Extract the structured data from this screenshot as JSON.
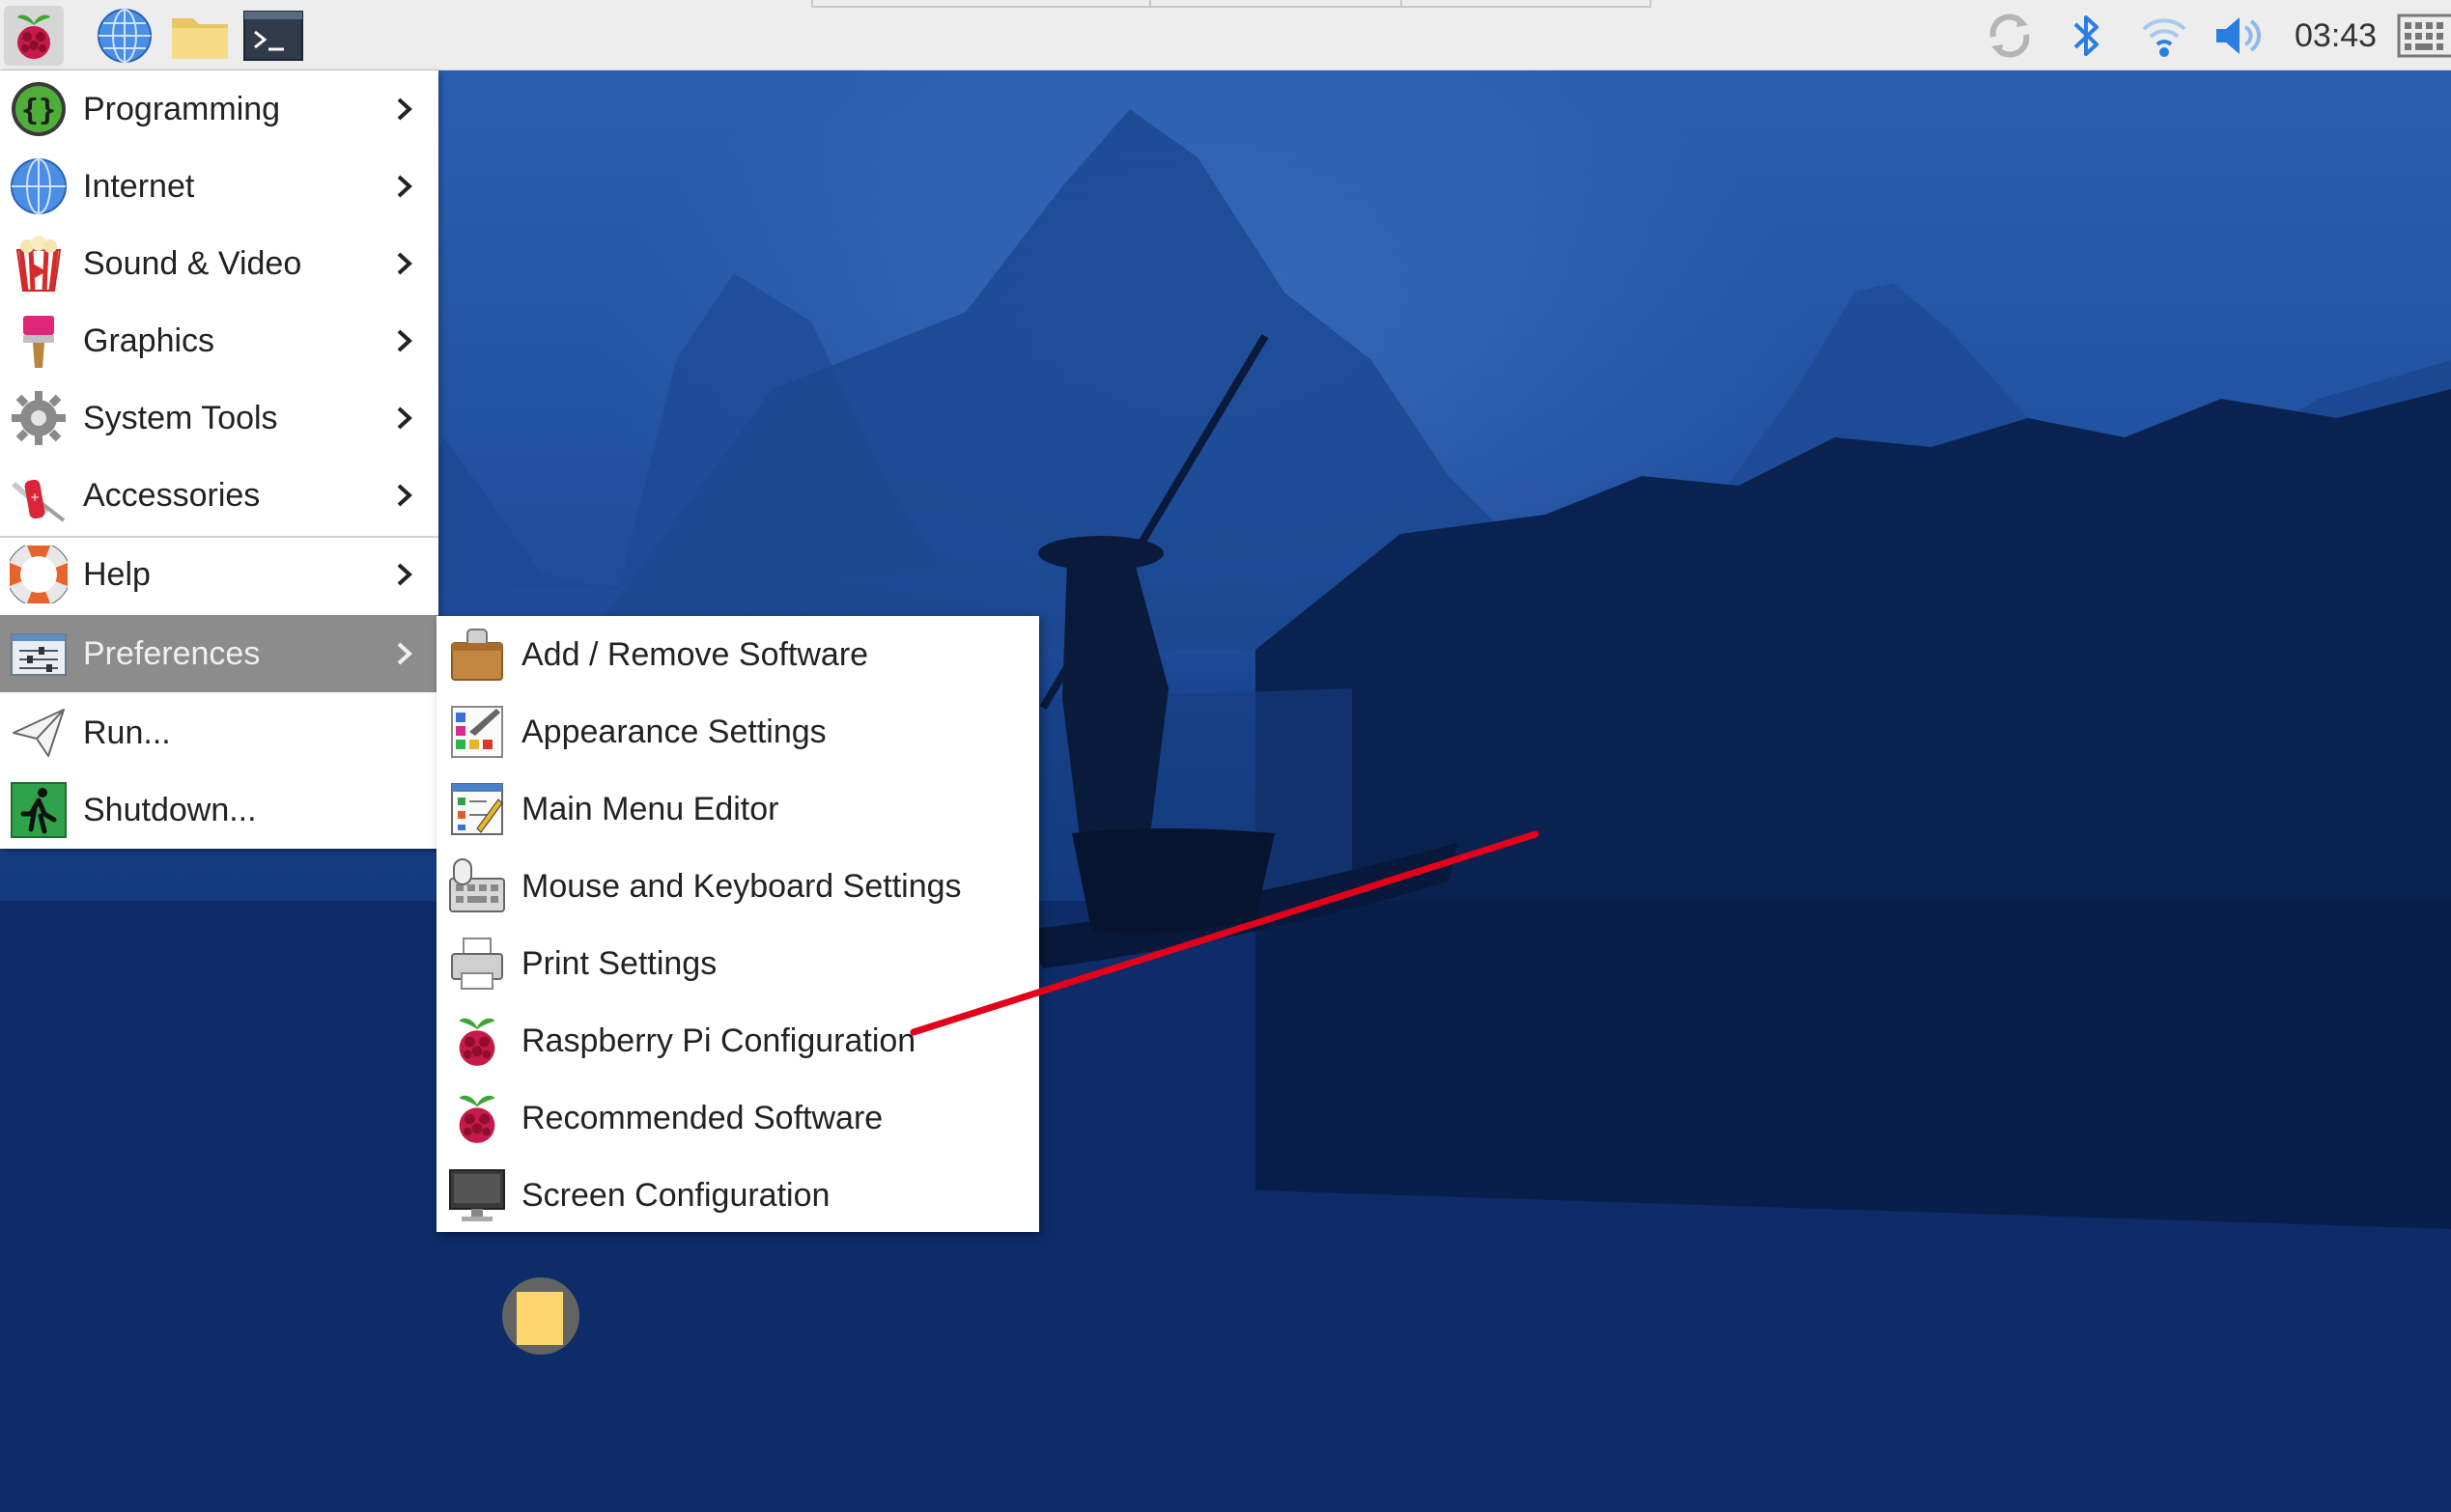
{
  "taskbar": {
    "clock": "03:43",
    "launchers": [
      "raspberry-menu",
      "web-browser",
      "file-manager",
      "terminal"
    ]
  },
  "main_menu": {
    "items": [
      {
        "label": "Programming",
        "icon": "programming-icon",
        "submenu": true
      },
      {
        "label": "Internet",
        "icon": "globe-icon",
        "submenu": true
      },
      {
        "label": "Sound & Video",
        "icon": "popcorn-icon",
        "submenu": true
      },
      {
        "label": "Graphics",
        "icon": "paintbrush-icon",
        "submenu": true
      },
      {
        "label": "System Tools",
        "icon": "gear-icon",
        "submenu": true
      },
      {
        "label": "Accessories",
        "icon": "pocket-knife-icon",
        "submenu": true
      },
      {
        "label": "Help",
        "icon": "lifebuoy-icon",
        "submenu": true
      },
      {
        "label": "Preferences",
        "icon": "sliders-icon",
        "submenu": true,
        "active": true
      },
      {
        "label": "Run...",
        "icon": "paper-plane-icon",
        "submenu": false
      },
      {
        "label": "Shutdown...",
        "icon": "exit-icon",
        "submenu": false
      }
    ]
  },
  "preferences_submenu": {
    "items": [
      {
        "label": "Add / Remove Software",
        "icon": "package-icon"
      },
      {
        "label": "Appearance Settings",
        "icon": "palette-icon"
      },
      {
        "label": "Main Menu Editor",
        "icon": "menu-editor-icon"
      },
      {
        "label": "Mouse and Keyboard Settings",
        "icon": "mouse-keyboard-icon"
      },
      {
        "label": "Print Settings",
        "icon": "printer-icon"
      },
      {
        "label": "Raspberry Pi Configuration",
        "icon": "raspberry-icon"
      },
      {
        "label": "Recommended Software",
        "icon": "raspberry-icon"
      },
      {
        "label": "Screen Configuration",
        "icon": "monitor-icon"
      }
    ]
  },
  "colors": {
    "menu_active": "#8c8c8c",
    "annotation": "#e3001b",
    "accent_blue": "#2a7de1"
  }
}
